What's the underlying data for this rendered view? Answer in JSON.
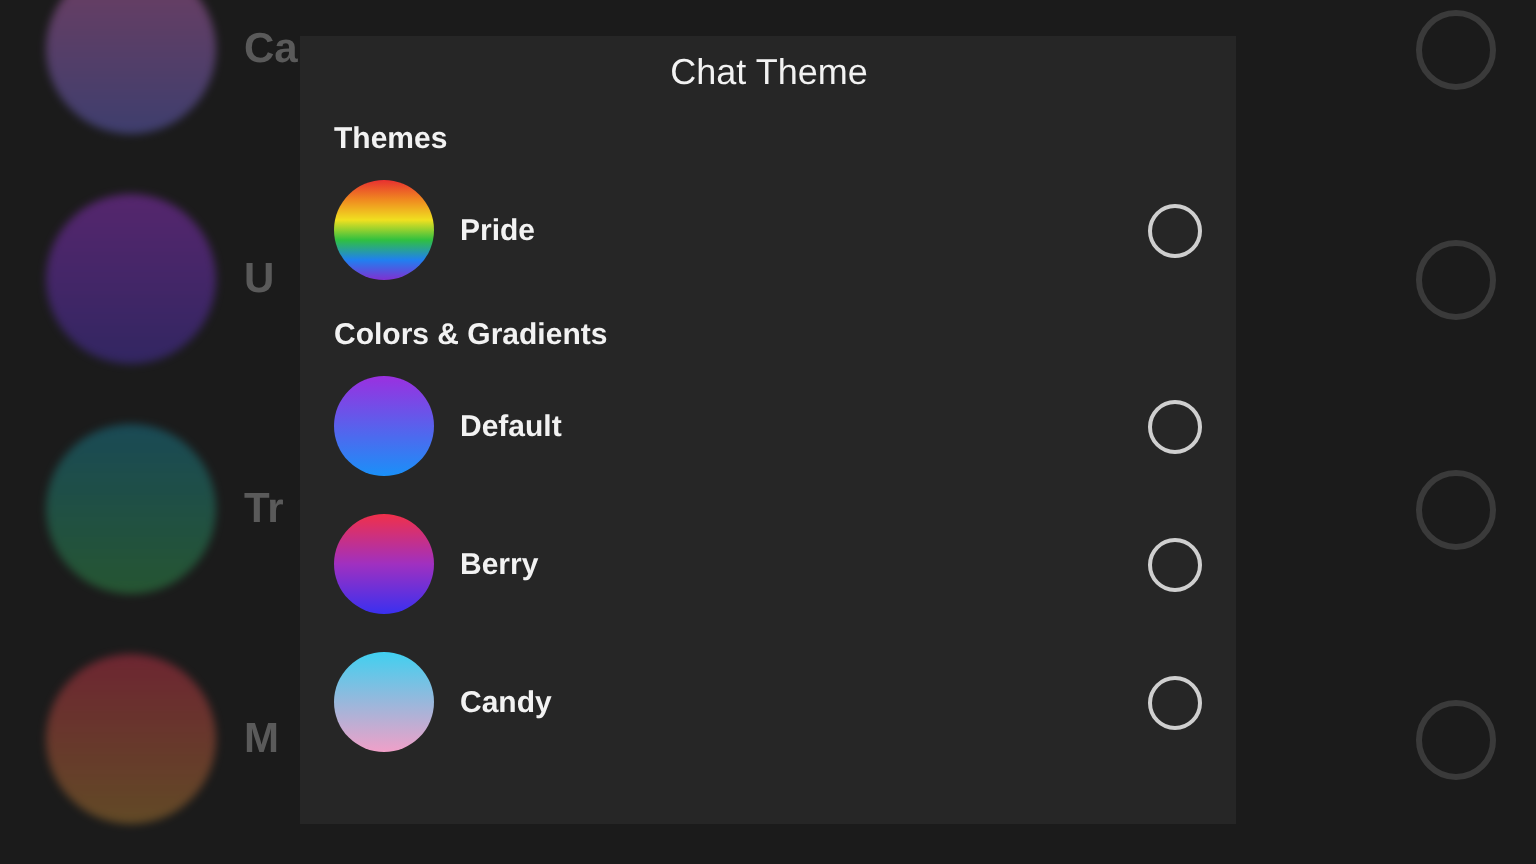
{
  "background_list": [
    {
      "label": "Ca",
      "kind": "mauve",
      "selected": false
    },
    {
      "label": "U",
      "kind": "violet",
      "selected": false
    },
    {
      "label": "Tr",
      "kind": "teal",
      "selected": false
    },
    {
      "label": "M",
      "kind": "rust",
      "selected": false
    }
  ],
  "sheet": {
    "title": "Chat Theme",
    "groups": [
      {
        "heading": "Themes",
        "items": [
          {
            "label": "Pride",
            "kind": "rainbow",
            "selected": false
          }
        ]
      },
      {
        "heading": "Colors & Gradients",
        "items": [
          {
            "label": "Default",
            "kind": "default",
            "selected": false
          },
          {
            "label": "Berry",
            "kind": "berry",
            "selected": false
          },
          {
            "label": "Candy",
            "kind": "candy",
            "selected": false
          }
        ]
      }
    ]
  }
}
